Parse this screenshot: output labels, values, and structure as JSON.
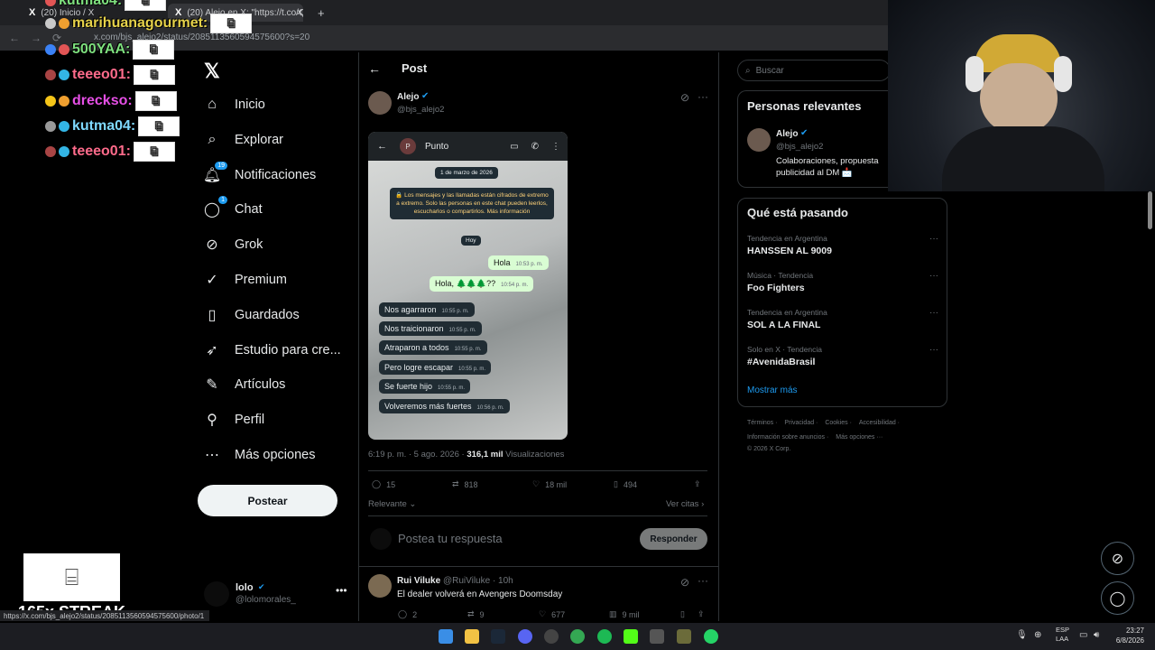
{
  "browser": {
    "tabs": [
      {
        "label": "(20) Inicio / X"
      },
      {
        "label": "(20) Alejo en X: \"https://t.co/Q..."
      }
    ],
    "url": "x.com/bjs_alejo2/status/2085113560594575600?s=20",
    "status_url": "https://x.com/bjs_alejo2/status/2085113560594575600/photo/1"
  },
  "chat_overlay": [
    {
      "user": "kutma04:"
    },
    {
      "user": "marihuanagourmet:"
    },
    {
      "user": "500YAA:"
    },
    {
      "user": "teeeo01:"
    },
    {
      "user": "drecksо:"
    },
    {
      "user": "kutma04:"
    },
    {
      "user": "teeeo01:"
    }
  ],
  "streak": "165x STREAK",
  "nav": {
    "items": [
      {
        "label": "Inicio"
      },
      {
        "label": "Explorar"
      },
      {
        "label": "Notificaciones",
        "badge": "19"
      },
      {
        "label": "Chat",
        "badge": "1"
      },
      {
        "label": "Grok"
      },
      {
        "label": "Premium"
      },
      {
        "label": "Guardados"
      },
      {
        "label": "Estudio para cre..."
      },
      {
        "label": "Artículos"
      },
      {
        "label": "Perfil"
      },
      {
        "label": "Más opciones"
      }
    ],
    "post_button": "Postear",
    "profile_name": "lolo",
    "profile_handle": "@lolomorales_"
  },
  "main": {
    "header_title": "Post",
    "author_name": "Alejo",
    "author_handle": "@bjs_alejo2",
    "image": {
      "contact_initial": "P",
      "contact_name": "Punto",
      "date_chip": "1 de marzo de 2026",
      "encryption_notice": "🔒 Los mensajes y las llamadas están cifrados de extremo a extremo. Solo las personas en este chat pueden leerlos, escucharlos o compartirlos. Más información",
      "today_chip": "Hoy",
      "outgoing": [
        {
          "text": "Hola",
          "time": "10:53 p. m."
        },
        {
          "text": "Hola, 🌲🌲🌲??",
          "time": "10:54 p. m."
        }
      ],
      "incoming": [
        {
          "text": "Nos agarraron",
          "time": "10:55 p. m."
        },
        {
          "text": "Nos traicionaron",
          "time": "10:55 p. m."
        },
        {
          "text": "Atraparon a todos",
          "time": "10:55 p. m."
        },
        {
          "text": "Pero logre escapar",
          "time": "10:55 p. m."
        },
        {
          "text": "Se fuerte hijo",
          "time": "10:55 p. m."
        },
        {
          "text": "Volveremos más fuertes",
          "time": "10:56 p. m."
        }
      ]
    },
    "meta_time": "6:19 p. m. · 5 ago. 2026 ·",
    "meta_views_count": "316,1 mil",
    "meta_views_label": "Visualizaciones",
    "actions": {
      "replies": "15",
      "reposts": "818",
      "likes": "18 mil",
      "bookmarks": "494"
    },
    "sort_label": "Relevante",
    "quotes_link": "Ver citas",
    "reply_placeholder": "Postea tu respuesta",
    "reply_button": "Responder",
    "reply_tweet": {
      "name": "Rui Viluke",
      "handle": "@RuiViluke",
      "time": "· 10h",
      "text": "El dealer volverá en Avengers Doomsday",
      "replies": "2",
      "reposts": "9",
      "likes": "677",
      "views": "9 mil"
    }
  },
  "right": {
    "search_placeholder": "Buscar",
    "relevant_title": "Personas relevantes",
    "relevant_person": {
      "name": "Alejo",
      "handle": "@bjs_alejo2",
      "bio": "Colaboraciones, propuesta publicidad al DM 📩"
    },
    "trends_title": "Qué está pasando",
    "trends": [
      {
        "context": "Tendencia en Argentina",
        "title": "HANSSEN AL 9009"
      },
      {
        "context": "Música · Tendencia",
        "title": "Foo Fighters"
      },
      {
        "context": "Tendencia en Argentina",
        "title": "SOL A LA FINAL"
      },
      {
        "context": "Solo en X · Tendencia",
        "title": "#AvenidaBrasil"
      }
    ],
    "show_more": "Mostrar más",
    "footer": {
      "line1": [
        "Términos",
        "Privacidad",
        "Cookies",
        "Accesibilidad"
      ],
      "line2": [
        "Información sobre anuncios",
        "Más opciones ···"
      ],
      "copyright": "© 2026 X Corp."
    }
  },
  "taskbar": {
    "lang": "ESP",
    "lang2": "LAA",
    "time": "23:27",
    "date": "6/8/2026"
  },
  "colors": {
    "accent": "#1d9bf0",
    "bg": "#000000",
    "border": "#2f3336",
    "muted": "#71767b"
  }
}
